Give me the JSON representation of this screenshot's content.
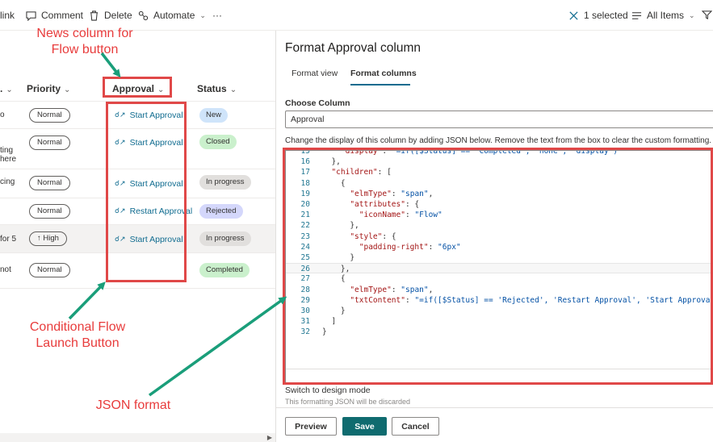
{
  "command_bar": {
    "link_label": "link",
    "comment_label": "Comment",
    "delete_label": "Delete",
    "automate_label": "Automate",
    "more_label": "···",
    "selected_label": "1 selected",
    "view_label": "All Items"
  },
  "list": {
    "headers": {
      "truncated": ".",
      "priority": "Priority",
      "approval": "Approval",
      "status": "Status"
    },
    "rows": [
      {
        "title_fragment": "o",
        "priority": "Normal",
        "approval": "Start Approval",
        "status": "New"
      },
      {
        "title_fragment": "ting\nhere",
        "priority": "Normal",
        "approval": "Start Approval",
        "status": "Closed"
      },
      {
        "title_fragment": "cing",
        "priority": "Normal",
        "approval": "Start Approval",
        "status": "In progress"
      },
      {
        "title_fragment": "",
        "priority": "Normal",
        "approval": "Restart Approval",
        "status": "Rejected"
      },
      {
        "title_fragment": "for 5",
        "priority": "High",
        "approval": "Start Approval",
        "status": "In progress"
      },
      {
        "title_fragment": "not",
        "priority": "Normal",
        "approval": "",
        "status": "Completed"
      }
    ],
    "status_colors": {
      "New": "#cfe4fa",
      "Closed": "#caf0cc",
      "In progress": "#e1dfdd",
      "Rejected": "#d4d7fb",
      "Completed": "#caf0cc"
    },
    "flow_icon": "flow-icon",
    "high_priority_icon": "arrow-up-icon"
  },
  "panel": {
    "title": "Format Approval column",
    "tabs": [
      "Format view",
      "Format columns"
    ],
    "active_tab": "Format columns",
    "choose_label": "Choose Column",
    "choose_value": "Approval",
    "help_text": "Change the display of this column by adding JSON below. Remove the text from the box to clear the custom formatting. Le",
    "code_lines": [
      {
        "num": "15",
        "text": "    \"display\": \"=if([$Status] == 'Completed', 'none', 'display')\""
      },
      {
        "num": "16",
        "text": "  },"
      },
      {
        "num": "17",
        "text": "  \"children\": ["
      },
      {
        "num": "18",
        "text": "    {"
      },
      {
        "num": "19",
        "text": "      \"elmType\": \"span\","
      },
      {
        "num": "20",
        "text": "      \"attributes\": {"
      },
      {
        "num": "21",
        "text": "        \"iconName\": \"Flow\""
      },
      {
        "num": "22",
        "text": "      },"
      },
      {
        "num": "23",
        "text": "      \"style\": {"
      },
      {
        "num": "24",
        "text": "        \"padding-right\": \"6px\""
      },
      {
        "num": "25",
        "text": "      }"
      },
      {
        "num": "26",
        "text": "    },"
      },
      {
        "num": "27",
        "text": "    {"
      },
      {
        "num": "28",
        "text": "      \"elmType\": \"span\","
      },
      {
        "num": "29",
        "text": "      \"txtContent\": \"=if([$Status] == 'Rejected', 'Restart Approval', 'Start Approval')\""
      },
      {
        "num": "30",
        "text": "    }"
      },
      {
        "num": "31",
        "text": "  ]"
      },
      {
        "num": "32",
        "text": "}"
      }
    ],
    "design_mode_link": "Switch to design mode",
    "discard_note": "This formatting JSON will be discarded",
    "buttons": {
      "preview": "Preview",
      "save": "Save",
      "cancel": "Cancel"
    }
  },
  "annotations": {
    "news_column": "News column for\nFlow button",
    "conditional": "Conditional Flow\nLaunch Button",
    "json_format": "JSON format"
  },
  "colors": {
    "accent": "#0f6b8f",
    "primary_button": "#0f6b6f",
    "annotation_red": "#e04848",
    "annotation_arrow": "#1a9e7a"
  }
}
